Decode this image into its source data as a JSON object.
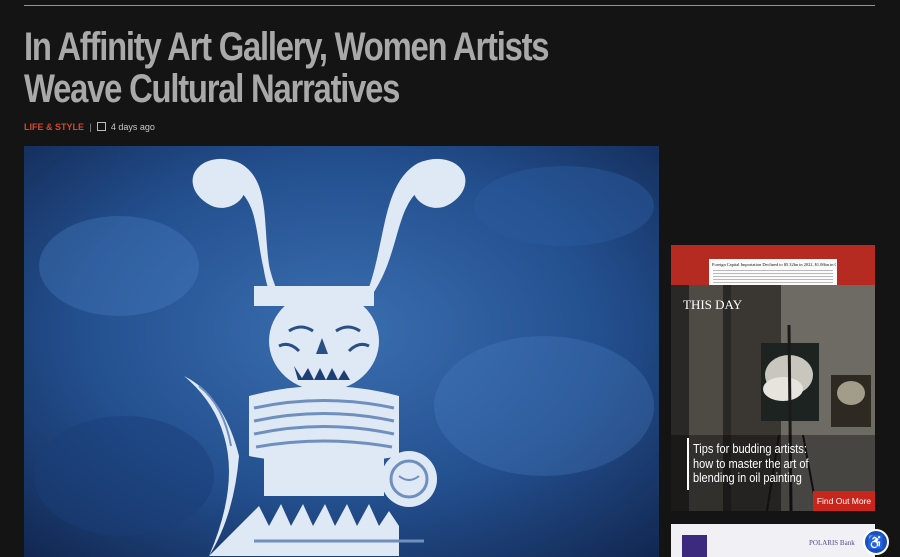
{
  "article": {
    "title": "In Affinity Art Gallery, Women Artists Weave Cultural Narratives",
    "category": "LIFE & STYLE",
    "separator": "|",
    "date": "4 days ago"
  },
  "ad": {
    "headline": "Foreign Capital Importation Declined to $5.32bn in 2022, $1.06bn in Q4",
    "logo": "THIS DAY",
    "text": "Tips for budding artists: how to master the art of blending in oil painting",
    "cta": "Find Out More"
  },
  "ad2": {
    "brand": "POLARIS Bank"
  },
  "colors": {
    "accent": "#d6452e",
    "rule": "#b8962e",
    "cta": "#c8261d"
  }
}
